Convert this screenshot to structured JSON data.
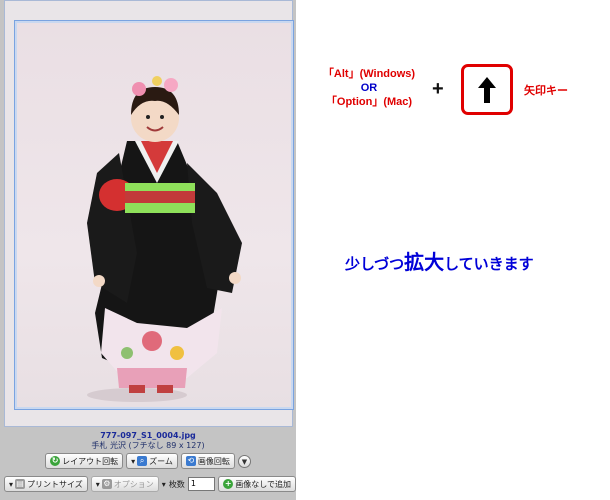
{
  "file_info": {
    "filename": "777-097_S1_0004.jpg",
    "details": "手札 光沢 (フチなし 89 x 127)"
  },
  "toolbar_row1": {
    "layout_rotate": "レイアウト回転",
    "zoom": "ズーム",
    "image_rotate": "画像回転"
  },
  "toolbar_row2": {
    "print_size": "プリントサイズ",
    "options": "オプション",
    "count_label": "枚数",
    "count_value": "1",
    "add_without_image": "画像なしで追加"
  },
  "instruction": {
    "key_alt": "「Alt」(Windows)",
    "or": "OR",
    "key_option": "「Option」(Mac)",
    "plus": "+",
    "arrow_label": "矢印キー",
    "zoom_part1": "少しづつ",
    "zoom_big": "拡大",
    "zoom_part2": "していきます"
  },
  "colors": {
    "red": "#e00000",
    "blue": "#0000d8"
  },
  "icons": [
    "up-arrow-icon",
    "layout-rotate-icon",
    "zoom-icon",
    "image-rotate-icon",
    "print-size-icon",
    "options-icon",
    "add-icon",
    "dropdown-icon"
  ]
}
